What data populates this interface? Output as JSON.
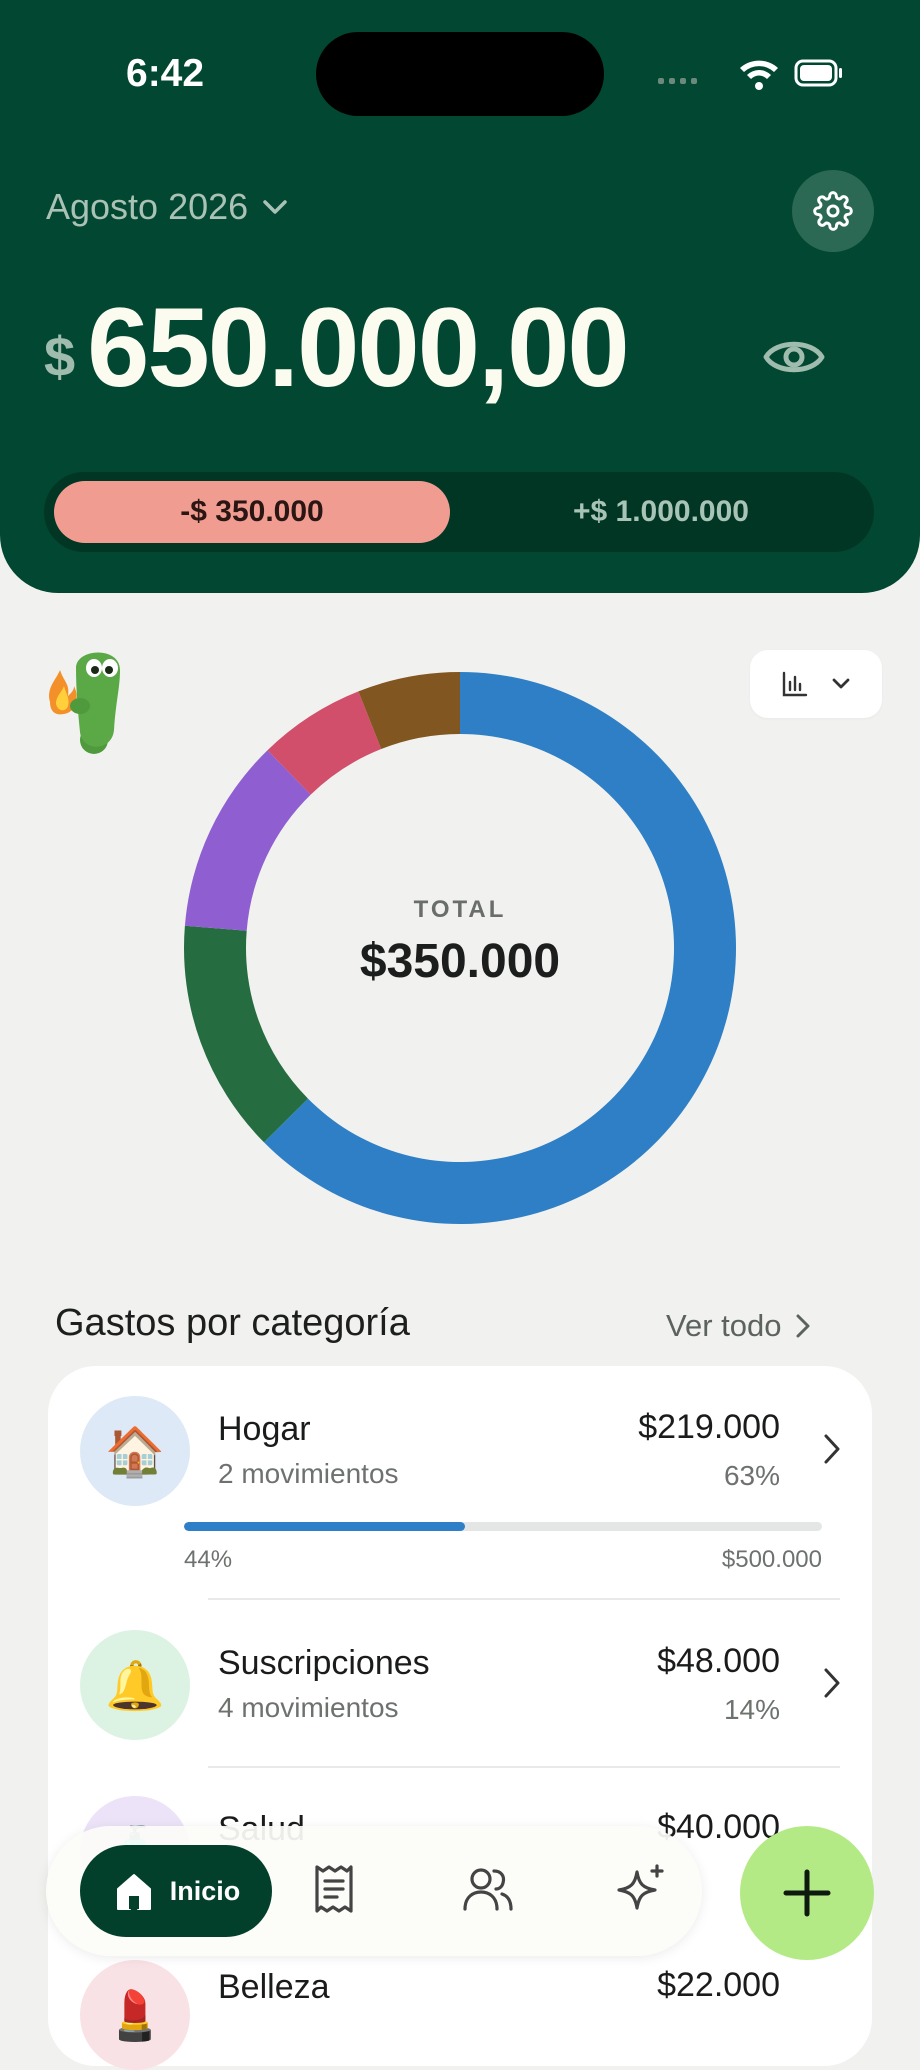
{
  "status_bar": {
    "time": "6:42"
  },
  "header": {
    "month": "Agosto 2026",
    "currency_symbol": "$",
    "balance": "650.000,00",
    "expenses": "-$ 350.000",
    "income": "+$ 1.000.000"
  },
  "chart": {
    "center_label": "TOTAL",
    "center_value": "$350.000"
  },
  "chart_data": {
    "type": "pie",
    "title": "",
    "segments": [
      {
        "value": 219000,
        "color": "#2e7fc6"
      },
      {
        "value": 48000,
        "color": "#256d41"
      },
      {
        "value": 40000,
        "color": "#8f5fd1"
      },
      {
        "value": 22000,
        "color": "#d24f6c"
      },
      {
        "value": 21000,
        "color": "#825620"
      }
    ],
    "start_angle_deg": 0,
    "direction": "clockwise"
  },
  "colors": {
    "header_bg": "#024731",
    "expense_pill": "#f19c91",
    "fab": "#b4ea85",
    "progress": "#2d7fc7"
  },
  "categories_section": {
    "title": "Gastos por categoría",
    "see_all": "Ver todo",
    "items": [
      {
        "name": "Hogar",
        "movements": "2 movimientos",
        "amount": "$219.000",
        "percent": "63%",
        "icon": "house-icon",
        "emoji": "🏠",
        "avatar_color": "#dde9f6",
        "budget_used_label": "44%",
        "budget_used_fraction": 0.44,
        "budget": "$500.000"
      },
      {
        "name": "Suscripciones",
        "movements": "4 movimientos",
        "amount": "$48.000",
        "percent": "14%",
        "icon": "bell-icon",
        "emoji": "🔔",
        "avatar_color": "#dcf3e3"
      },
      {
        "name": "Salud",
        "movements": "",
        "amount": "$40.000",
        "percent": "",
        "icon": "health-icon",
        "emoji": "🧴",
        "avatar_color": "#ece3f8"
      },
      {
        "name": "Belleza",
        "movements": "",
        "amount": "$22.000",
        "percent": "",
        "icon": "beauty-icon",
        "emoji": "💄",
        "avatar_color": "#f9e2e5"
      }
    ]
  },
  "nav": {
    "home_label": "Inicio",
    "items": [
      "receipt-icon",
      "people-icon",
      "sparkles-icon"
    ]
  }
}
